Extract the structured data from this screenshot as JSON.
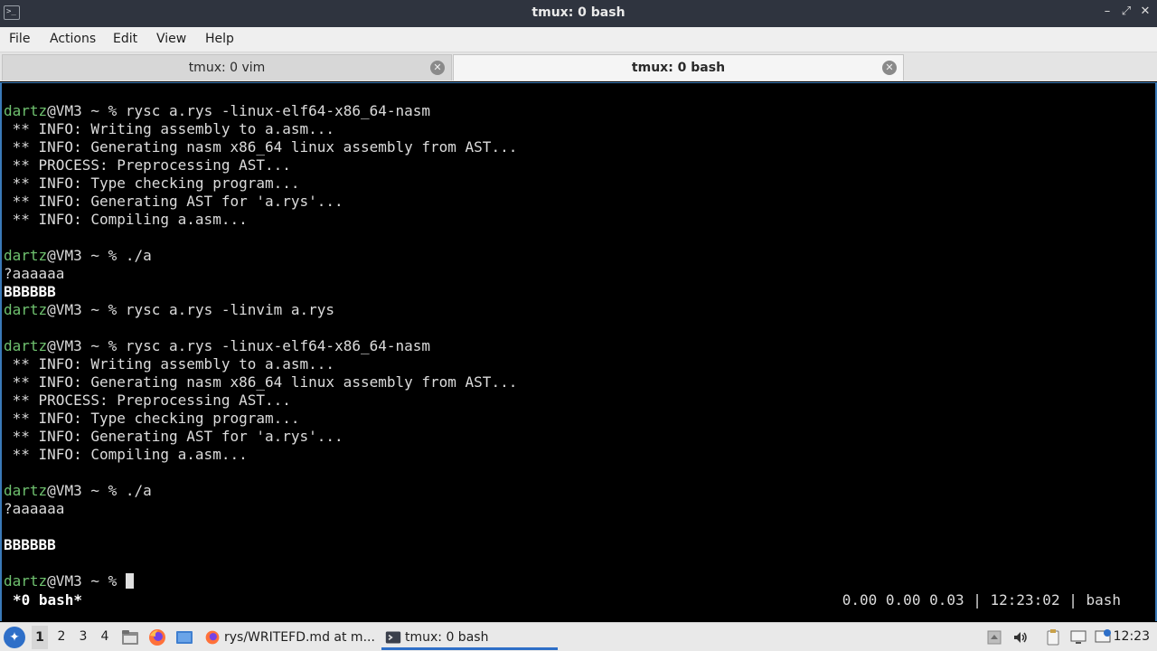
{
  "window": {
    "title": "tmux: 0 bash",
    "icon": "terminal-icon",
    "controls": {
      "minimize": "–",
      "maximize": "⤢",
      "close": "✕"
    }
  },
  "menu": {
    "items": [
      "File",
      "Actions",
      "Edit",
      "View",
      "Help"
    ]
  },
  "tabs": [
    {
      "label": "tmux: 0 vim",
      "active": false
    },
    {
      "label": "tmux: 0 bash",
      "active": true
    }
  ],
  "terminal": {
    "lines": [
      {
        "prompt_user": "dartz",
        "prompt_rest": "@VM3 ~ % ",
        "text": "rysc a.rys -linux-elf64-x86_64-nasm"
      },
      {
        "text": " ** INFO: Writing assembly to a.asm..."
      },
      {
        "text": " ** INFO: Generating nasm x86_64 linux assembly from AST..."
      },
      {
        "text": " ** PROCESS: Preprocessing AST..."
      },
      {
        "text": " ** INFO: Type checking program..."
      },
      {
        "text": " ** INFO: Generating AST for 'a.rys'..."
      },
      {
        "text": " ** INFO: Compiling a.asm..."
      },
      {
        "text": ""
      },
      {
        "prompt_user": "dartz",
        "prompt_rest": "@VM3 ~ % ",
        "text": "./a"
      },
      {
        "text": "?aaaaaa"
      },
      {
        "text": "BBBBBB",
        "bold": true
      },
      {
        "prompt_user": "dartz",
        "prompt_rest": "@VM3 ~ % ",
        "text": "rysc a.rys -linvim a.rys"
      },
      {
        "text": ""
      },
      {
        "prompt_user": "dartz",
        "prompt_rest": "@VM3 ~ % ",
        "text": "rysc a.rys -linux-elf64-x86_64-nasm"
      },
      {
        "text": " ** INFO: Writing assembly to a.asm..."
      },
      {
        "text": " ** INFO: Generating nasm x86_64 linux assembly from AST..."
      },
      {
        "text": " ** PROCESS: Preprocessing AST..."
      },
      {
        "text": " ** INFO: Type checking program..."
      },
      {
        "text": " ** INFO: Generating AST for 'a.rys'..."
      },
      {
        "text": " ** INFO: Compiling a.asm..."
      },
      {
        "text": ""
      },
      {
        "prompt_user": "dartz",
        "prompt_rest": "@VM3 ~ % ",
        "text": "./a"
      },
      {
        "text": "?aaaaaa"
      },
      {
        "text": ""
      },
      {
        "text": "BBBBBB",
        "bold": true
      },
      {
        "text": ""
      },
      {
        "prompt_user": "dartz",
        "prompt_rest": "@VM3 ~ % ",
        "text": "",
        "cursor": true
      }
    ],
    "status": {
      "left": "*0 bash*",
      "right": "0.00 0.00 0.03 | 12:23:02 | bash"
    }
  },
  "taskbar": {
    "start_icon": "start-menu-icon",
    "workspaces": [
      "1",
      "2",
      "3",
      "4"
    ],
    "active_workspace": "1",
    "launchers": [
      "file-manager-icon",
      "firefox-icon",
      "desktop-icon"
    ],
    "tasks": [
      {
        "label": "rys/WRITEFD.md at m...",
        "icon": "firefox-icon",
        "active": false
      },
      {
        "label": "tmux: 0 bash",
        "icon": "terminal-icon",
        "active": true
      }
    ],
    "tray": [
      "eject-icon",
      "volume-icon",
      "clipboard-icon",
      "monitor-icon",
      "update-icon"
    ],
    "clock": "12:23"
  },
  "colors": {
    "titlebar": "#2f343f",
    "prompt_user": "#6fc16f",
    "accent": "#2e6fc8",
    "terminal_bg": "#000000"
  }
}
